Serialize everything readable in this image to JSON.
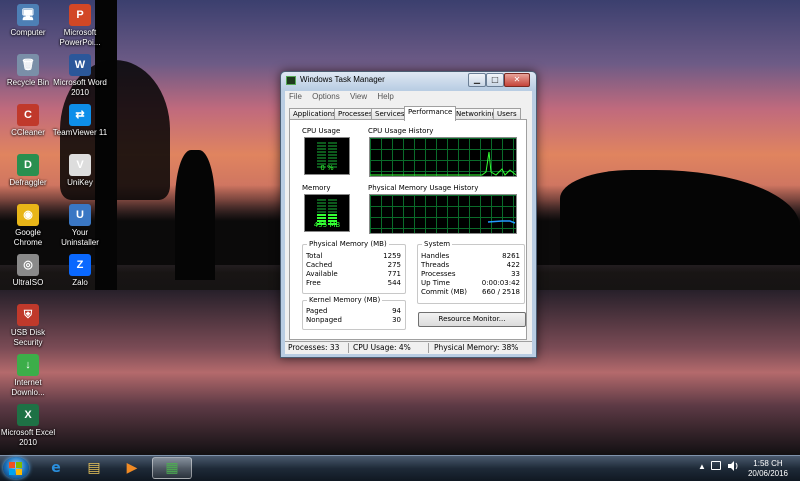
{
  "desktop": {
    "icons": [
      {
        "label": "Computer",
        "color": "#4d7fb5",
        "glyph": "🖥"
      },
      {
        "label": "Microsoft PowerPoi...",
        "color": "#d24726",
        "glyph": "P"
      },
      {
        "label": "Recycle Bin",
        "color": "#7a8fa8",
        "glyph": "🗑"
      },
      {
        "label": "Microsoft Word 2010",
        "color": "#2b579a",
        "glyph": "W"
      },
      {
        "label": "CCleaner",
        "color": "#c0392b",
        "glyph": "C"
      },
      {
        "label": "TeamViewer 11",
        "color": "#0e8ee9",
        "glyph": "⇄"
      },
      {
        "label": "Defraggler",
        "color": "#2a8f4f",
        "glyph": "D"
      },
      {
        "label": "UniKey",
        "color": "#dddddd",
        "glyph": "V"
      },
      {
        "label": "Google Chrome",
        "color": "#e8b518",
        "glyph": "◉"
      },
      {
        "label": "Your Uninstaller",
        "color": "#3a77c4",
        "glyph": "U"
      },
      {
        "label": "UltraISO",
        "color": "#8a8a8a",
        "glyph": "◎"
      },
      {
        "label": "Zalo",
        "color": "#0a68fe",
        "glyph": "Z"
      },
      {
        "label": "USB Disk Security",
        "color": "#c0392b",
        "glyph": "⛨"
      },
      {
        "label": "Internet Downlo...",
        "color": "#3cae49",
        "glyph": "↓"
      },
      {
        "label": "Microsoft Excel 2010",
        "color": "#1e7145",
        "glyph": "X"
      }
    ]
  },
  "window": {
    "title": "Windows Task Manager",
    "min_glyph": "▁",
    "max_glyph": "□",
    "close_glyph": "✕",
    "menu": [
      "File",
      "Options",
      "View",
      "Help"
    ],
    "tabs": [
      "Applications",
      "Processes",
      "Services",
      "Performance",
      "Networking",
      "Users"
    ],
    "active_tab": "Performance",
    "cpu_usage_label": "CPU Usage",
    "cpu_usage_value": "0 %",
    "cpu_history_label": "CPU Usage History",
    "memory_label": "Memory",
    "memory_value": "455 MB",
    "memory_history_label": "Physical Memory Usage History",
    "physical_memory": {
      "title": "Physical Memory (MB)",
      "rows": [
        {
          "k": "Total",
          "v": "1259"
        },
        {
          "k": "Cached",
          "v": "275"
        },
        {
          "k": "Available",
          "v": "771"
        },
        {
          "k": "Free",
          "v": "544"
        }
      ]
    },
    "kernel_memory": {
      "title": "Kernel Memory (MB)",
      "rows": [
        {
          "k": "Paged",
          "v": "94"
        },
        {
          "k": "Nonpaged",
          "v": "30"
        }
      ]
    },
    "system": {
      "title": "System",
      "rows": [
        {
          "k": "Handles",
          "v": "8261"
        },
        {
          "k": "Threads",
          "v": "422"
        },
        {
          "k": "Processes",
          "v": "33"
        },
        {
          "k": "Up Time",
          "v": "0:00:03:42"
        },
        {
          "k": "Commit (MB)",
          "v": "660 / 2518"
        }
      ]
    },
    "resource_monitor_button": "Resource Monitor...",
    "status": {
      "processes": "Processes: 33",
      "cpu": "CPU Usage: 4%",
      "memory": "Physical Memory: 38%"
    }
  },
  "taskbar": {
    "time": "1:58 CH",
    "date": "20/06/2016",
    "show_hidden_glyph": "▲",
    "pinned": [
      {
        "name": "internet-explorer",
        "glyph": "e",
        "color": "#2a8fdd"
      },
      {
        "name": "file-explorer",
        "glyph": "▤",
        "color": "#e8c35a"
      },
      {
        "name": "media-player",
        "glyph": "▶",
        "color": "#f08a24"
      },
      {
        "name": "task-manager",
        "glyph": "▦",
        "color": "#4caf50"
      }
    ]
  }
}
